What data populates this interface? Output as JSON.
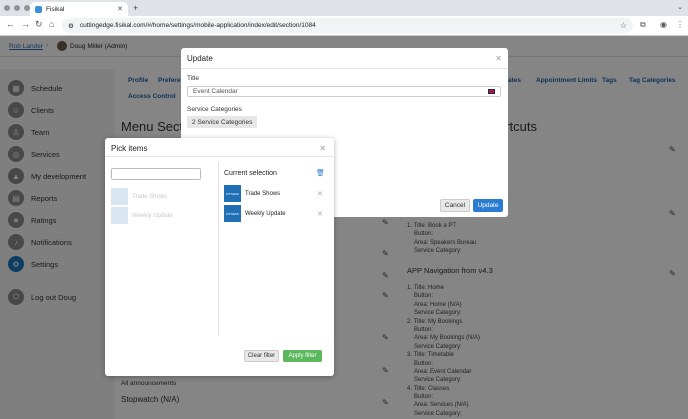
{
  "browser": {
    "tab_title": "Fisikal",
    "url": "cuttingedge.fisikal.com/#/home/settings/mobile-application/index/edit/section/1084"
  },
  "header": {
    "breadcrumb": "Rob Lander",
    "user_name": "Doug Miller (Admin)"
  },
  "sidebar": {
    "items": [
      {
        "label": "Schedule",
        "icon": "calendar-icon"
      },
      {
        "label": "Clients",
        "icon": "people-icon"
      },
      {
        "label": "Team",
        "icon": "person-icon"
      },
      {
        "label": "Services",
        "icon": "globe-icon"
      },
      {
        "label": "My development",
        "icon": "rocket-icon"
      },
      {
        "label": "Reports",
        "icon": "document-icon"
      },
      {
        "label": "Ratings",
        "icon": "star-icon"
      },
      {
        "label": "Notifications",
        "icon": "bell-icon"
      },
      {
        "label": "Settings",
        "icon": "gear-icon"
      },
      {
        "label": "Log out Doug",
        "icon": "power-icon"
      }
    ]
  },
  "main": {
    "tabs": [
      "Profile",
      "Preferen",
      "dates",
      "Appointment Limits",
      "Tags",
      "Tag Categories",
      "Access Control"
    ],
    "menu_title": "Menu Sect",
    "shortcuts_title": "ortcuts",
    "left_snippets": {
      "announcements": "All announcements",
      "stopwatch": "Stopwatch (N/A)"
    },
    "right_block_1": [
      "1. Title: Book a PT",
      "Button:",
      "Area: Speakers Bureau",
      "Service Category:"
    ],
    "right_heading": "APP Navigation from v4.3",
    "right_block_2": [
      "1. Title: Home",
      "Button:",
      "Area: Home (N/A)",
      "Service Category:",
      "2. Title: My Bookings",
      "Button:",
      "Area: My Bookings (N/A)",
      "Service Category:",
      "3. Title: Timetable",
      "Button:",
      "Area: Event Calendar",
      "Service Category:",
      "4. Title: Classes",
      "Button:",
      "Area: Services (N/A)",
      "Service Category:"
    ]
  },
  "update_modal": {
    "title": "Update",
    "title_label": "Title",
    "title_value": "Event Calendar",
    "categories_label": "Service Categories",
    "categories_pill": "2 Service Categories",
    "cancel": "Cancel",
    "update": "Update"
  },
  "pick_modal": {
    "title": "Pick items",
    "available": [
      "Trade Shows",
      "Weekly Update"
    ],
    "selection_title": "Current selection",
    "selected": [
      "Trade Shows",
      "Weekly Update"
    ],
    "thumb_text": "FITNESS",
    "clear": "Clear filter",
    "apply": "Apply filter"
  }
}
